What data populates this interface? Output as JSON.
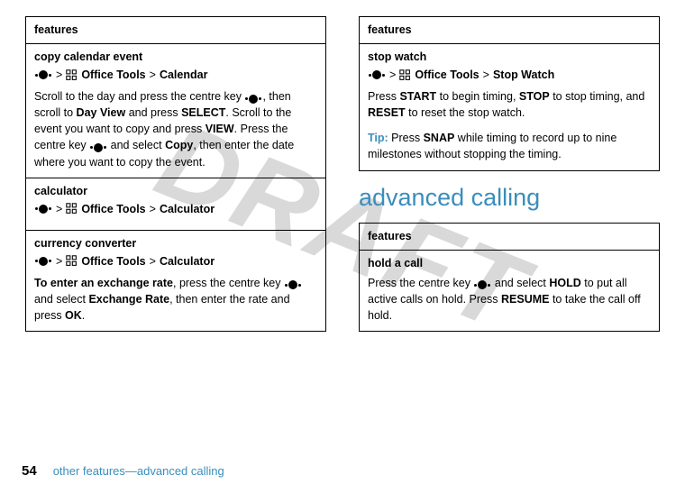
{
  "watermark": "DRAFT",
  "left": {
    "header": "features",
    "copy_cal": {
      "title": "copy calendar event",
      "path_tools": "Office Tools",
      "path_dest": "Calendar",
      "text_a": "Scroll to the day and press the centre key ",
      "text_b": ", then scroll to ",
      "day_view": "Day View",
      "text_c": " and press ",
      "select": "SELECT",
      "text_d": ". Scroll to the event you want to copy and press ",
      "view": "VIEW",
      "text_e": ". Press the centre key ",
      "text_f": " and select ",
      "copy": "Copy",
      "text_g": ", then enter the date where you want to copy the event."
    },
    "calc": {
      "title": "calculator",
      "path_tools": "Office Tools",
      "path_dest": "Calculator"
    },
    "curr": {
      "title": "currency converter",
      "path_tools": "Office Tools",
      "path_dest": "Calculator",
      "lead": "To enter an exchange rate",
      "text_a": ", press the centre key ",
      "text_b": " and select ",
      "ex_rate": "Exchange Rate",
      "text_c": ", then enter the rate and press ",
      "ok": "OK",
      "text_d": "."
    }
  },
  "right": {
    "header": "features",
    "stopwatch": {
      "title": "stop watch",
      "path_tools": "Office Tools",
      "path_dest": "Stop Watch",
      "text_a": "Press ",
      "start": "START",
      "text_b": " to begin timing, ",
      "stop": "STOP",
      "text_c": " to stop timing, and ",
      "reset": "RESET",
      "text_d": " to reset the stop watch.",
      "tip_label": "Tip:",
      "tip_a": " Press ",
      "snap": "SNAP",
      "tip_b": " while timing to record up to nine milestones without stopping the timing."
    },
    "heading": "advanced calling",
    "hold": {
      "header": "features",
      "title": "hold a call",
      "text_a": "Press the centre key ",
      "text_b": " and select ",
      "hold_label": "HOLD",
      "text_c": " to put all active calls on hold. Press ",
      "resume": "RESUME",
      "text_d": " to take the call off hold."
    }
  },
  "footer": {
    "page": "54",
    "text": "other features—advanced calling"
  },
  "gt": ">"
}
